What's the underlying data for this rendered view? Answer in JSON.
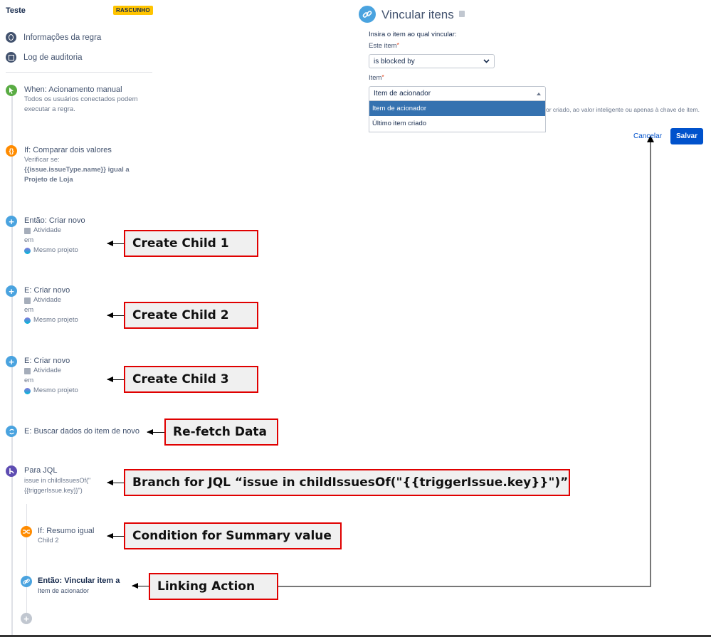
{
  "sidebar": {
    "rule_name": "Teste",
    "status_badge": "RASCUNHO",
    "menu": [
      {
        "label": "Informações da regra",
        "icon": "info-icon"
      },
      {
        "label": "Log de auditoria",
        "icon": "audit-log-icon"
      }
    ]
  },
  "flow": {
    "trigger": {
      "title": "When: Acionamento manual",
      "desc1": "Todos os usuários conectados podem",
      "desc2": "executar a regra."
    },
    "condition": {
      "title": "If: Comparar dois valores",
      "line1": "Verificar se:",
      "line2": "{{issue.issueType.name}} igual a",
      "line3": "Projeto de Loja"
    },
    "create": [
      {
        "title": "Então: Criar novo",
        "type": "Atividade",
        "em": "em",
        "project": "Mesmo projeto"
      },
      {
        "title": "E: Criar novo",
        "type": "Atividade",
        "em": "em",
        "project": "Mesmo projeto"
      },
      {
        "title": "E: Criar novo",
        "type": "Atividade",
        "em": "em",
        "project": "Mesmo projeto"
      }
    ],
    "refetch": {
      "title": "E: Buscar dados do item de novo"
    },
    "branch": {
      "title": "Para JQL",
      "line1": "issue in childIssuesOf(\"",
      "line2": "{{triggerIssue.key}}\")"
    },
    "branch_condition": {
      "title": "If: Resumo igual",
      "sub": "Child 2"
    },
    "link_action": {
      "title": "Então: Vincular item a",
      "sub": "Item de acionador"
    }
  },
  "callouts": {
    "create1": "Create Child 1",
    "create2": "Create Child 2",
    "create3": "Create Child 3",
    "refetch": "Re-fetch Data",
    "branch": "Branch for JQL “issue in childIssuesOf(\"{{triggerIssue.key}}\")”",
    "condition": "Condition for Summary value",
    "linking": "Linking Action"
  },
  "panel": {
    "title": "Vincular itens",
    "instruction": "Insira o item ao qual vincular:",
    "this_item_label": "Este item",
    "required_mark": "*",
    "link_type_value": "is blocked by",
    "item_label": "Item",
    "item_input_value": "Item de acionador",
    "item_options": [
      "Item de acionador",
      "Último item criado"
    ],
    "selected_option": "Item de acionador",
    "help_text": "or criado, ao valor inteligente ou apenas à chave de item.",
    "cancel_label": "Cancelar",
    "save_label": "Salvar"
  },
  "colors": {
    "trigger": "#5aac44",
    "condition": "#ff8b00",
    "action": "#4aa3df",
    "branch": "#5e4db2",
    "add": "#c1c7d0",
    "callout_border": "#e00000",
    "primary": "#0052cc",
    "badge": "#ffc400"
  }
}
